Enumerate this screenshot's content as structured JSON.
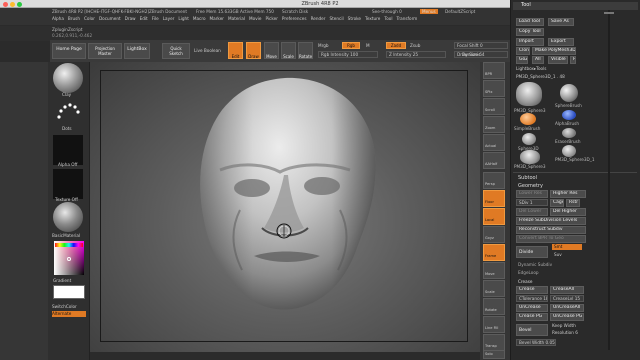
{
  "window": {
    "title": "ZBrush 4R8 P2",
    "document_info": "ZBrush 4R8 P2 [IHCHE-ITGF-QHFK-FBKI-NGH2]ZBrush Document",
    "free_mem": "Free Mem 15.633GB",
    "active_mem": "Active Mem 750",
    "scratch_disk": "Scratch Disk",
    "see_through": "See-through 0",
    "menus_btn": "Menus",
    "default_script": "DefaultZScript"
  },
  "menubar": {
    "items": [
      "Alpha",
      "Brush",
      "Color",
      "Document",
      "Draw",
      "Edit",
      "File",
      "Layer",
      "Light",
      "Macro",
      "Marker",
      "Material",
      "Movie",
      "Picker",
      "Preferences",
      "Render",
      "Stencil",
      "Stroke",
      "Texture",
      "Tool",
      "Transform"
    ],
    "row2": [
      "Zplugin",
      "Zscript"
    ],
    "coords": "0.262,0.911,-0.462"
  },
  "toolbar": {
    "home_page": "Home Page",
    "projection_master": "Projection Master",
    "lightbox": "LightBox",
    "quick_sketch": "Quick Sketch",
    "live_boolean": "Live Boolean",
    "edit": "Edit",
    "draw": "Draw",
    "move": "Move",
    "scale": "Scale",
    "rotate": "Rotate",
    "mrgb": "Mrgb",
    "rgb": "Rgb",
    "m": "M",
    "zadd": "Zadd",
    "zsub": "Zsub",
    "rgb_intensity": "Rgb Intensity 100",
    "z_intensity": "Z Intensity 25",
    "focal_shift": "Focal Shift 0",
    "draw_size": "Draw Size 64",
    "dynamic": "Dynamic"
  },
  "left_shelf": {
    "brush": "Clay",
    "stroke": "Dots",
    "alpha": "Alpha Off",
    "texture": "Texture Off",
    "material": "BasicMaterial",
    "gradient": "Gradient",
    "switch_color": "SwitchColor",
    "alternate": "Alternate"
  },
  "right_shelf": {
    "buttons": [
      "BPR",
      "SPix",
      "Scroll",
      "Zoom",
      "Actual",
      "AAHalf",
      "Persp",
      "Floor",
      "Local",
      "Gxyz",
      "Frame",
      "Move",
      "Scale",
      "Rotate",
      "Line Fill",
      "Transp",
      "Solo"
    ]
  },
  "tool_palette": {
    "header": "Tool",
    "load_tool": "Load Tool",
    "save_as": "Save As",
    "copy_tool": "Copy Tool",
    "paste_tool": "Paste Tool",
    "import": "Import",
    "export": "Export",
    "clone": "Clone",
    "make_polymesh": "Make PolyMesh3D",
    "goz": "GoZ",
    "all": "All",
    "visible": "Visible",
    "r": "R",
    "lightbox_tools": "Lightbox▸Tools",
    "current_tool": "PM3D_Sphere3D_1 . 48",
    "thumbs": [
      "PM3D_Sphere3",
      "SphereBrush",
      "AlphaBrush",
      "SimpleBrush",
      "EraserBrush",
      "Sphere3D",
      "PM3D_Sphere3D_1",
      "PM3D_Sphere3"
    ],
    "subtool": "Subtool",
    "geometry": "Geometry",
    "higher_res": "Higher Res",
    "lower_res": "Lower Res",
    "sdiv": "SDiv 1",
    "cage": "Cage",
    "rstr": "Rstr",
    "del_lower": "Del Lower",
    "del_higher": "Del Higher",
    "freeze_subdiv": "Freeze SubDivision Levels",
    "reconstruct_subdiv": "Reconstruct Subdiv",
    "convert_bpr": "Convert BPR To Geo",
    "divide": "Divide",
    "smt": "Smt",
    "suv": "Suv",
    "dynamic_subdiv": "Dynamic Subdiv",
    "edgeloop": "EdgeLoop",
    "crease_section": "Crease",
    "crease": "Crease",
    "crease_all": "CreaseAll",
    "crease_tolerance": "CTolerance 180",
    "crease_lvl": "CreaseLvl 15",
    "uncrease": "UnCrease",
    "uncrease_all": "UnCreaseAll",
    "crease_pg": "Crease PG",
    "uncrease_pg": "UnCrease PG",
    "bevel": "Bevel",
    "bevel_width": "Bevel Width 0.05",
    "keep_width": "Keep Width",
    "resolution": "Resolution 6"
  },
  "colors": {
    "accent": "#e07a24",
    "panel": "#2a2a2a",
    "button": "#4b4b4b",
    "canvas_center": "#7e7e7e"
  }
}
